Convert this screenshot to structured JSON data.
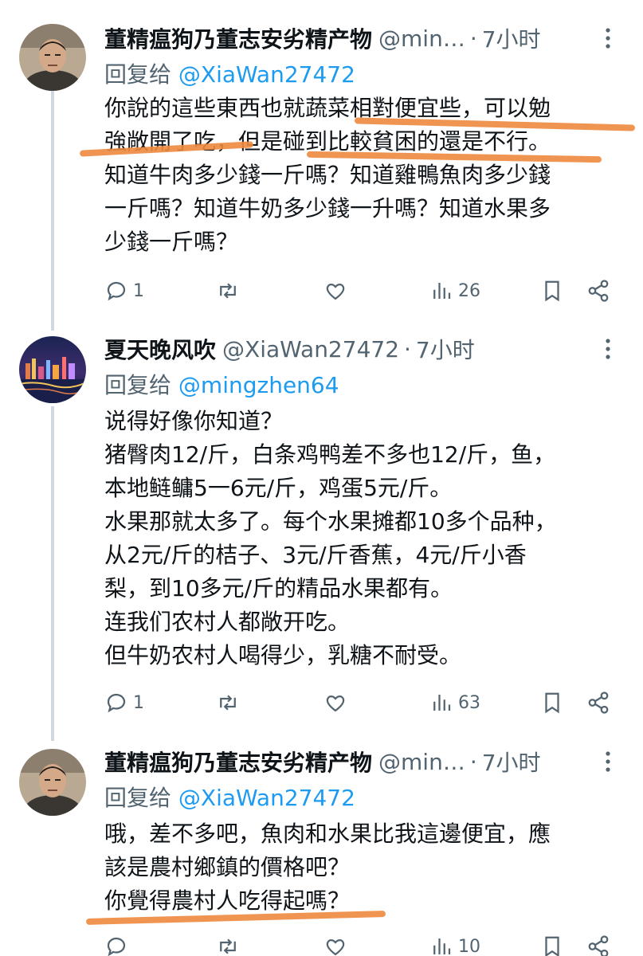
{
  "tweets": [
    {
      "name": "董精瘟狗乃董志安劣精产物",
      "handle": "@min…",
      "sep": "·",
      "time": "7小时",
      "reply_label": "回复给",
      "reply_to": "@XiaWan27472",
      "lines": [
        "你說的這些東西也就蔬菜相對便宜些，可以勉",
        "強敞開了吃，但是碰到比較貧困的還是不行。",
        "知道牛肉多少錢一斤嗎？知道雞鴨魚肉多少錢",
        "一斤嗎？知道牛奶多少錢一升嗎？知道水果多",
        "少錢一斤嗎？"
      ],
      "replies": "1",
      "views": "26",
      "avatar": "man-avatar"
    },
    {
      "name": "夏天晚风吹",
      "handle": "@XiaWan27472",
      "sep": "·",
      "time": "7小时",
      "reply_label": "回复给",
      "reply_to": "@mingzhen64",
      "lines": [
        "说得好像你知道？",
        "猪臀肉12/斤，白条鸡鸭差不多也12/斤，鱼，",
        "本地鲢鳙5一6元/斤，鸡蛋5元/斤。",
        "水果那就太多了。每个水果摊都10多个品种，",
        "从2元/斤的桔子、3元/斤香蕉，4元/斤小香",
        "梨，到10多元/斤的精品水果都有。",
        "连我们农村人都敞开吃。",
        "但牛奶农村人喝得少，乳糖不耐受。"
      ],
      "replies": "1",
      "views": "63",
      "avatar": "city-night-avatar"
    },
    {
      "name": "董精瘟狗乃董志安劣精产物",
      "handle": "@min…",
      "sep": "·",
      "time": "7小时",
      "reply_label": "回复给",
      "reply_to": "@XiaWan27472",
      "lines": [
        "哦，差不多吧，魚肉和水果比我這邊便宜，應",
        "該是農村鄉鎮的價格吧？",
        "你覺得農村人吃得起嗎？"
      ],
      "replies": "",
      "views": "10",
      "avatar": "man-avatar"
    }
  ],
  "colors": {
    "text": "#0f1419",
    "secondary": "#536471",
    "link": "#1d9bf0",
    "highlight_underline": "#ee8a3e"
  },
  "icons": [
    "reply-icon",
    "retweet-icon",
    "like-icon",
    "views-icon",
    "bookmark-icon",
    "share-icon",
    "more-icon"
  ]
}
